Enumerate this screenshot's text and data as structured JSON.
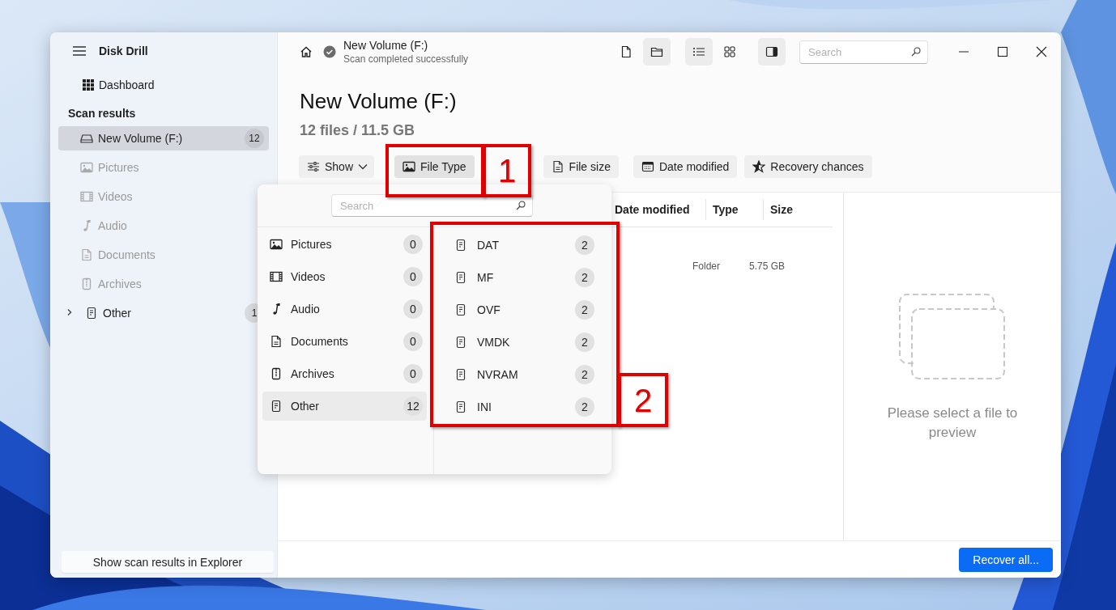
{
  "app": {
    "title": "Disk Drill"
  },
  "sidebar": {
    "dashboard": {
      "label": "Dashboard"
    },
    "section_title": "Scan results",
    "items": [
      {
        "kind": "volume",
        "label": "New Volume (F:)",
        "count": "12",
        "selected": true,
        "disabled": false
      },
      {
        "kind": "pictures",
        "label": "Pictures",
        "selected": false,
        "disabled": true
      },
      {
        "kind": "videos",
        "label": "Videos",
        "selected": false,
        "disabled": true
      },
      {
        "kind": "audio",
        "label": "Audio",
        "selected": false,
        "disabled": true
      },
      {
        "kind": "documents",
        "label": "Documents",
        "selected": false,
        "disabled": true
      },
      {
        "kind": "archives",
        "label": "Archives",
        "selected": false,
        "disabled": true
      },
      {
        "kind": "other",
        "label": "Other",
        "count": "1",
        "selected": false,
        "disabled": false,
        "expanded": false
      }
    ],
    "footer_button": "Show scan results in Explorer"
  },
  "header": {
    "title": "New Volume (F:)",
    "status": "Scan completed successfully",
    "view_buttons": [
      {
        "kind": "file",
        "selected": false
      },
      {
        "kind": "folder",
        "selected": true
      },
      {
        "kind": "list",
        "selected": true
      },
      {
        "kind": "grid",
        "selected": false
      },
      {
        "kind": "preview-pane",
        "selected": true
      }
    ],
    "search": {
      "placeholder": "Search"
    }
  },
  "content": {
    "title": "New Volume (F:)",
    "summary": "12 files / 11.5 GB",
    "filters": [
      {
        "kind": "show",
        "label": "Show",
        "selected": false
      },
      {
        "kind": "file-type",
        "label": "File Type",
        "selected": true
      },
      {
        "kind": "file-size",
        "label": "File size",
        "selected": false
      },
      {
        "kind": "date",
        "label": "Date modified",
        "selected": false
      },
      {
        "kind": "recovery",
        "label": "Recovery chances",
        "selected": false
      }
    ],
    "table": {
      "columns": [
        "Date modified",
        "Type",
        "Size"
      ],
      "rows": [
        {
          "type": "Folder",
          "size": "5.75 GB"
        }
      ]
    },
    "preview": {
      "message": "Please select a file to preview"
    },
    "footer_button": "Recover all..."
  },
  "file_type_popup": {
    "search": {
      "placeholder": "Search"
    },
    "categories": [
      {
        "kind": "pictures",
        "label": "Pictures",
        "count": "0",
        "selected": false
      },
      {
        "kind": "videos",
        "label": "Videos",
        "count": "0",
        "selected": false
      },
      {
        "kind": "audio",
        "label": "Audio",
        "count": "0",
        "selected": false
      },
      {
        "kind": "documents",
        "label": "Documents",
        "count": "0",
        "selected": false
      },
      {
        "kind": "archives",
        "label": "Archives",
        "count": "0",
        "selected": false
      },
      {
        "kind": "other",
        "label": "Other",
        "count": "12",
        "selected": true
      }
    ],
    "types": [
      {
        "label": "DAT",
        "count": "2"
      },
      {
        "label": "MF",
        "count": "2"
      },
      {
        "label": "OVF",
        "count": "2"
      },
      {
        "label": "VMDK",
        "count": "2"
      },
      {
        "label": "NVRAM",
        "count": "2"
      },
      {
        "label": "INI",
        "count": "2"
      }
    ]
  },
  "annotations": [
    {
      "label": "1"
    },
    {
      "label": "2"
    }
  ]
}
